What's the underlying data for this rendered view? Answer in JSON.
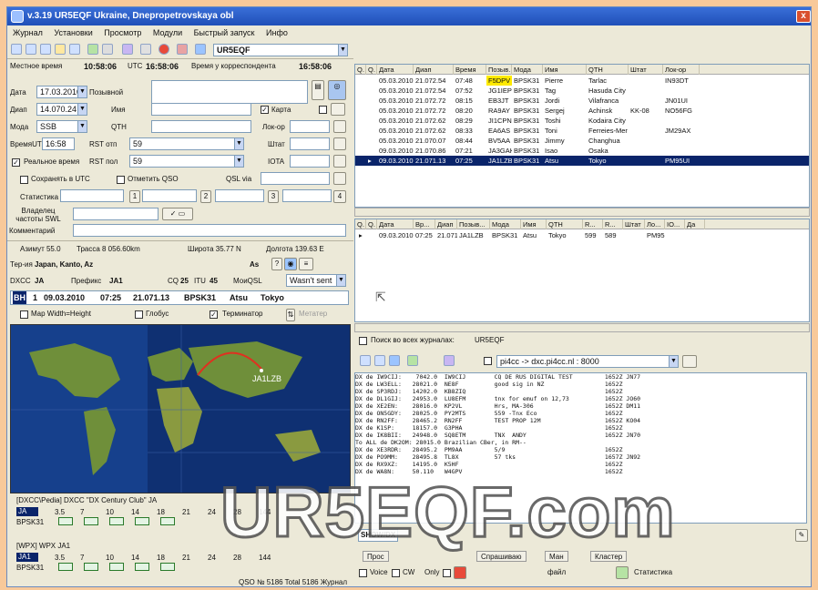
{
  "window": {
    "title": "v.3.19 UR5EQF Ukraine, Dnepropetrovskaya obl",
    "close": "x"
  },
  "menu": [
    "Журнал",
    "Установки",
    "Просмотр",
    "Модули",
    "Быстрый запуск",
    "Инфо"
  ],
  "callsign_combo": "UR5EQF",
  "timebar": {
    "local_label": "Местное время",
    "local": "10:58:06",
    "utc_label": "UTC",
    "utc": "16:58:06",
    "corr_label": "Время у корреспондента",
    "corr": "16:58:06"
  },
  "form": {
    "date_label": "Дата",
    "date": "17.03.2010",
    "callsign_label": "Позывной",
    "band_label": "Диап",
    "band": "14.070.24",
    "name_label": "Имя",
    "map_label": "Карта",
    "mode_label": "Мода",
    "mode": "SSB",
    "qth_label": "QTH",
    "locator_label": "Лок-ор",
    "utc_label": "ВремяUTC",
    "utc": "16:58",
    "rst_sent_label": "RST отп",
    "rst_sent": "59",
    "state_label": "Штат",
    "realtime_label": "Реальное время",
    "rst_recv_label": "RST пол",
    "rst_recv": "59",
    "iota_label": "IOTA",
    "save_utc_label": "Сохранять в UTC",
    "mark_qso_label": "Отметить QSO",
    "qsl_label": "QSL via",
    "stats_label": "Статистика",
    "n1": "1",
    "n2": "2",
    "n3": "3",
    "n4": "4",
    "owner_label": "Владелец частоты SWL",
    "comment_label": "Комментарий"
  },
  "info": {
    "azimuth": "Азимут 55.0",
    "path": "Трасса 8 056.60km",
    "lat": "Широта 35.77 N",
    "lon": "Долгота 139.63 E",
    "territory_label": "Тер-ия",
    "territory": "Japan, Kanto, Az",
    "as_label": "As",
    "dxcc_label": "DXCC",
    "dxcc": "JA",
    "prefix_label": "Префикс",
    "prefix": "JA1",
    "cq_label": "CQ",
    "cq": "25",
    "itu_label": "ITU",
    "itu": "45",
    "qsl_mode_label": "МоиQSL",
    "qsl_mode": "Wasn't sent"
  },
  "lastqso": {
    "n": "1",
    "date": "09.03.2010",
    "time": "07:25",
    "freq": "21.071.13",
    "mode": "BPSK31",
    "name": "Atsu",
    "qth": "Tokyo"
  },
  "mapbar": {
    "width_label": "Map Width=Height",
    "lines_label": "Глобус",
    "terminator_label": "Терминатор",
    "update_label": "Метатер"
  },
  "map": {
    "spot": "JA1LZB"
  },
  "bands1": {
    "title": "[DXCC\\Pedia] DXCC \"DX Century Club\" JA",
    "call": "JA",
    "mode": "BPSK31",
    "bands": [
      "3.5",
      "7",
      "10",
      "14",
      "18",
      "21",
      "24",
      "28",
      "144"
    ]
  },
  "bands2": {
    "title": "[WPX] WPX JA1",
    "call": "JA1",
    "mode": "BPSK31",
    "bands": [
      "3.5",
      "7",
      "10",
      "14",
      "18",
      "21",
      "24",
      "28",
      "144"
    ]
  },
  "status": "QSO № 5186 Total 5186 Журнал",
  "log": {
    "headers": [
      "Q.",
      "Q.",
      "Дата",
      "Диап",
      "Время",
      "Позыв...",
      "Мода",
      "Имя",
      "QTH",
      "Штат",
      "Лок-ор"
    ],
    "rows": [
      [
        "05.03.2010",
        "21.072.54",
        "07:48",
        "F5DPV",
        "BPSK31",
        "Pierre",
        "Tarlac",
        "",
        "IN93DT"
      ],
      [
        "05.03.2010",
        "21.072.54",
        "07:52",
        "JG1IEP",
        "BPSK31",
        "Tag",
        "Hasuda City",
        "",
        ""
      ],
      [
        "05.03.2010",
        "21.072.72",
        "08:15",
        "EB3JT",
        "BPSK31",
        "Jordi",
        "Vilafranca",
        "",
        "JN01UI"
      ],
      [
        "05.03.2010",
        "21.072.72",
        "08:20",
        "RA9AY",
        "BPSK31",
        "Sergej",
        "Achinsk",
        "KK-08",
        "NO56FG"
      ],
      [
        "05.03.2010",
        "21.072.62",
        "08:29",
        "JI1CPN",
        "BPSK31",
        "Toshi",
        "Kodaira City",
        "",
        ""
      ],
      [
        "05.03.2010",
        "21.072.62",
        "08:33",
        "EA6AS",
        "BPSK31",
        "Toni",
        "Ferreies-Mer",
        "",
        "JM29AX"
      ],
      [
        "05.03.2010",
        "21.070.07",
        "08:44",
        "BV5AA",
        "BPSK31",
        "Jimmy",
        "Changhua",
        "",
        ""
      ],
      [
        "09.03.2010",
        "21.070.86",
        "07:21",
        "JA3GAK",
        "BPSK31",
        "Isao",
        "Osaka",
        "",
        ""
      ],
      [
        "09.03.2010",
        "21.071.13",
        "07:25",
        "JA1LZB",
        "BPSK31",
        "Atsu",
        "Tokyo",
        "",
        "PM95UI"
      ]
    ]
  },
  "log2": {
    "headers": [
      "Q.",
      "Q.",
      "Дата",
      "Вр...",
      "Диап",
      "Позыв...",
      "Мода",
      "Имя",
      "QTH",
      "R...",
      "R...",
      "Штат",
      "Ло...",
      "IO...",
      "Да"
    ],
    "row": [
      "09.03.2010",
      "07:25",
      "21.071",
      "JA1LZB",
      "BPSK31",
      "Atsu",
      "Tokyo",
      "599",
      "589",
      "",
      "PM95"
    ]
  },
  "search": {
    "label": "Поиск во всех журналах:",
    "value": "UR5EQF"
  },
  "cluster": {
    "host": "pi4cc -> dxc.pi4cc.nl : 8000"
  },
  "spots": [
    "DX de IW9CIJ:    7042.0  IW9CIJ        CQ DE RUS DIGITAL TEST         1652Z JN77",
    "DX de LW3ELL:   28021.0  NE8F          good sig in NZ                 1652Z",
    "DX de SP3RDJ:   14202.0  KB8ZIQ                                       1652Z",
    "DX de DL1GIJ:   24953.0  LU8EFM        tnx for emuf on 12,73          1652Z JO60",
    "DX de XE2EN:    28016.0  KP2VL         Hrs, MA-306                    1652Z DM11",
    "DX de ON5GDY:   28025.0  PY2MTS        559 -Tnx Eco                   1652Z",
    "DX de RN2FF:    28465.2  RN2FF         TEST PROP 12M                  1652Z KO04",
    "DX de K1SP:     18157.0  G3PHA                                        1652Z",
    "DX de IK8BII:   24948.0  SQ8ETM        TNX  ANDY                      1652Z JN70",
    "To ALL de DK2OM: 28015.0 Brazilian CBer, in RM--",
    "DX de XE3RDR:   28495.2  PM9AA         5/9                            1652Z",
    "DX de PO9MM:    28495.8  TL8X          57 tks                         1657Z JN92",
    "DX de RX9XZ:    14195.0  K5HF                                         1652Z",
    "DX de WA8N:     50.110   W4GPV                                        1652Z"
  ],
  "bottom": {
    "show": "SHOW/DX",
    "voice_label": "Voice",
    "cw_label": "CW",
    "only_label": "Only",
    "file_label": "файл",
    "stats_label": "Статистика"
  },
  "tabs": [
    "Прос",
    "Спрашиваю",
    "Ман",
    "Кластер"
  ],
  "watermark": "UR5EQF.com"
}
